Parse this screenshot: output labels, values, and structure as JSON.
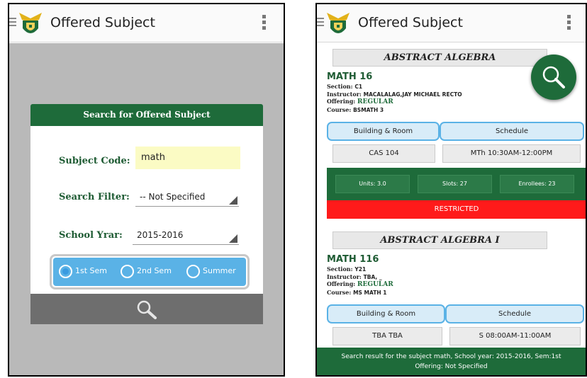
{
  "colors": {
    "primary_green": "#1e6b3a",
    "accent_blue": "#5ab2e6",
    "restricted_red": "#ff1a1a",
    "input_yellow": "#fbfbc4"
  },
  "app": {
    "title": "Offered Subject",
    "menu_icon": "hamburger-icon",
    "overflow_icon": "kebab-icon",
    "logo_icon": "seal-logo-icon"
  },
  "search_dialog": {
    "title": "Search for Offered Subject",
    "subject_code_label": "Subject Code:",
    "subject_code_value": "math",
    "search_filter_label": "Search Filter:",
    "search_filter_value": "-- Not Specified",
    "school_year_label": "School Yrar:",
    "school_year_value": "2015-2016",
    "semesters": [
      {
        "label": "1st Sem",
        "selected": true
      },
      {
        "label": "2nd Sem",
        "selected": false
      },
      {
        "label": "Summer",
        "selected": false
      }
    ],
    "search_icon": "search-icon"
  },
  "results": [
    {
      "title": "ABSTRACT ALGEBRA",
      "code": "MATH 16",
      "section_label": "Section:",
      "section": "C1",
      "instructor_label": "Instructor:",
      "instructor": "MACALALAG,JAY MICHAEL RECTO",
      "offering_label": "Offering:",
      "offering": "REGULAR",
      "course_label": "Course:",
      "course": "BSMATH 3",
      "building_label": "Building & Room",
      "schedule_label": "Schedule",
      "room": "CAS 104",
      "schedule": "MTh 10:30AM-12:00PM",
      "units": "Units: 3.0",
      "slots": "Slots: 27",
      "enrollees": "Enrollees: 23",
      "status": "RESTRICTED"
    },
    {
      "title": "ABSTRACT ALGEBRA I",
      "code": "MATH 116",
      "section_label": "Section:",
      "section": "Y21",
      "instructor_label": "Instructor:",
      "instructor": "TBA, _",
      "offering_label": "Offering:",
      "offering": "REGULAR",
      "course_label": "Course:",
      "course": "MS MATH 1",
      "building_label": "Building & Room",
      "schedule_label": "Schedule",
      "room": "TBA TBA",
      "schedule": "S 08:00AM-11:00AM"
    }
  ],
  "footer": {
    "line1": "Search result for the subject math, School year: 2015-2016, Sem:1st",
    "line2": "Offering: Not Specified"
  }
}
